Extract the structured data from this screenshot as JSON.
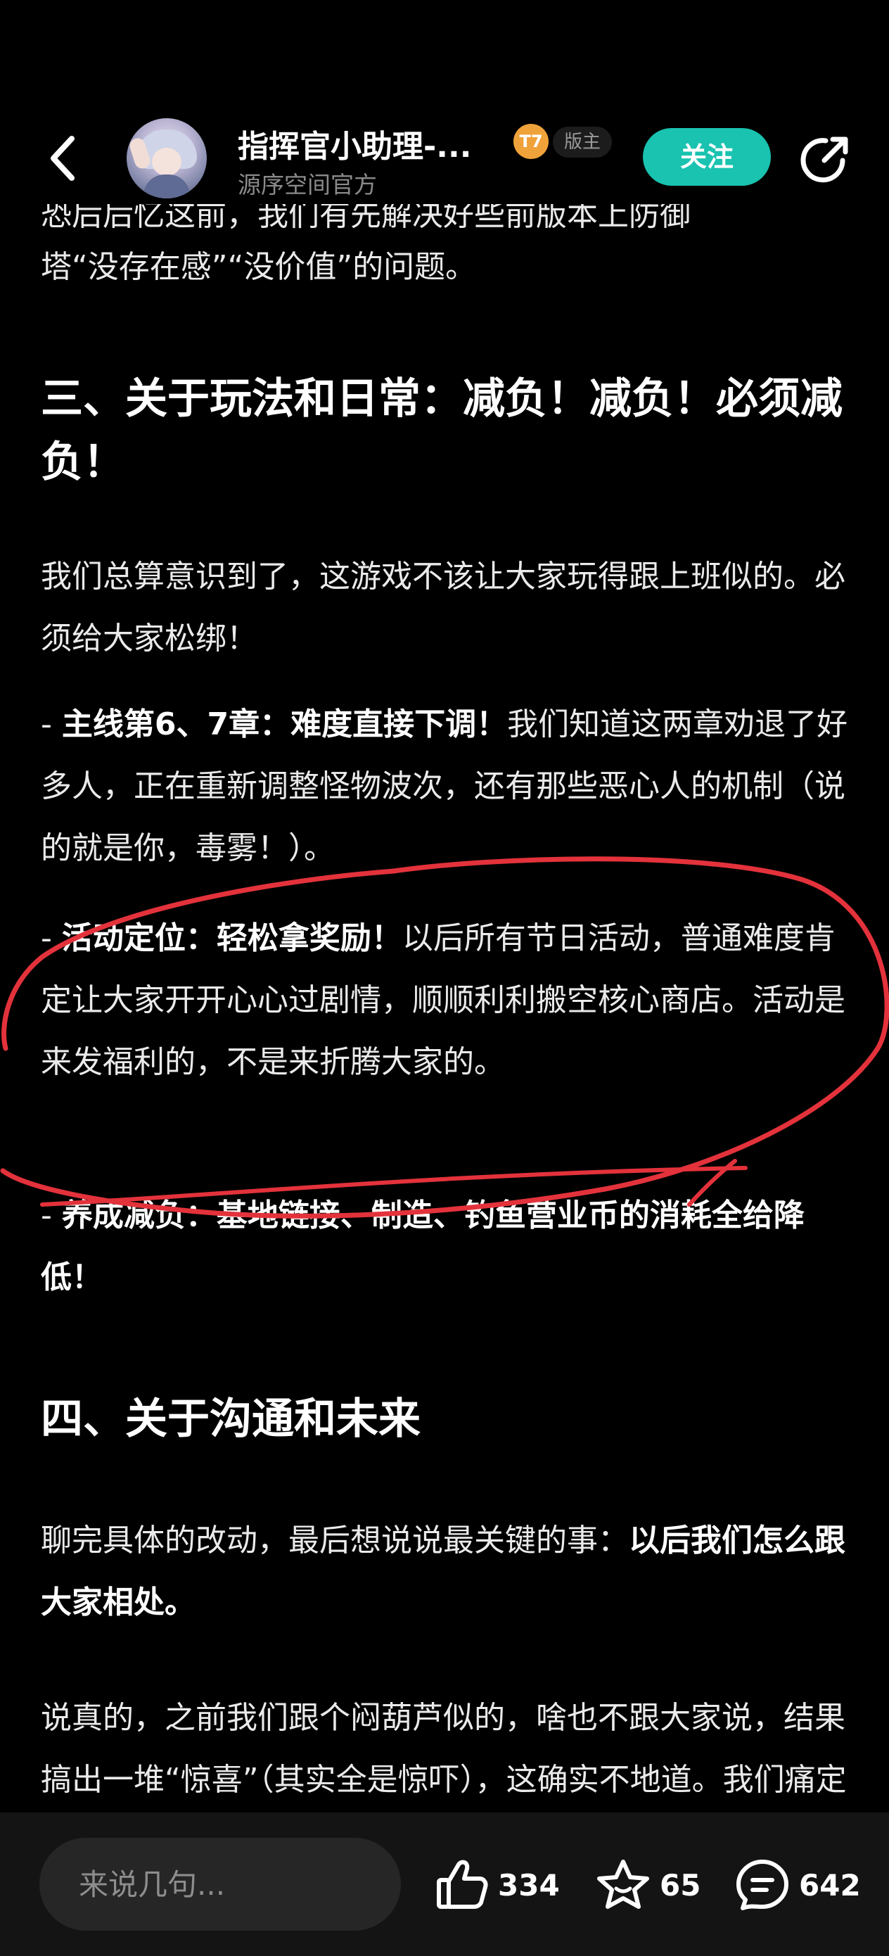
{
  "header": {
    "account_name": "指挥官小助理-...",
    "account_org": "源序空间官方",
    "level_badge": "T7",
    "role_badge": "版主",
    "follow_label": "关注"
  },
  "article": {
    "cut_line": "恐后后忆这前，我们有先解决好些前版本上防御",
    "tail": "塔“没存在感”“没价值”的问题。",
    "section3_title": "三、关于玩法和日常：减负！减负！必须减负！",
    "section3_intro": "我们总算意识到了，这游戏不该让大家玩得跟上班似的。必须给大家松绑！",
    "bullet1_prefix": "- ",
    "bullet1_bold": "主线第6、7章：难度直接下调！",
    "bullet1_text": "我们知道这两章劝退了好多人，正在重新调整怪物波次，还有那些恶心人的机制（说的就是你，毒雾！）。",
    "bullet2_prefix": "- ",
    "bullet2_bold": "活动定位：轻松拿奖励！",
    "bullet2_text": "以后所有节日活动，普通难度肯定让大家开开心心过剧情，顺顺利利搬空核心商店。活动是来发福利的，不是来折腾大家的。",
    "bullet3_prefix": "- ",
    "bullet3_bold": "养成减负：基地链接、制造、钓鱼营业币的消耗全给降低！",
    "section4_title": "四、关于沟通和未来",
    "section4_p1_text": "聊完具体的改动，最后想说说最关键的事：",
    "section4_p1_bold": "以后我们怎么跟大家相处。",
    "section4_p2": "说真的，之前我们跟个闷葫芦似的，啥也不跟大家说，结果搞出一堆“惊喜”（其实全是惊吓），这确实不地道。我们痛定思痛，决定以后就打开"
  },
  "bottom_bar": {
    "comment_placeholder": "来说几句...",
    "like_count": "334",
    "favorite_count": "65",
    "comment_count": "642"
  },
  "icons": {
    "back": "chevron-left-icon",
    "share": "share-icon",
    "like": "thumbs-up-icon",
    "favorite": "star-icon",
    "comment": "comment-bubble-icon"
  },
  "colors": {
    "background": "#000000",
    "accent": "#19c3b0",
    "annotation_red": "#e3323b",
    "bottom_bar": "#141414"
  }
}
